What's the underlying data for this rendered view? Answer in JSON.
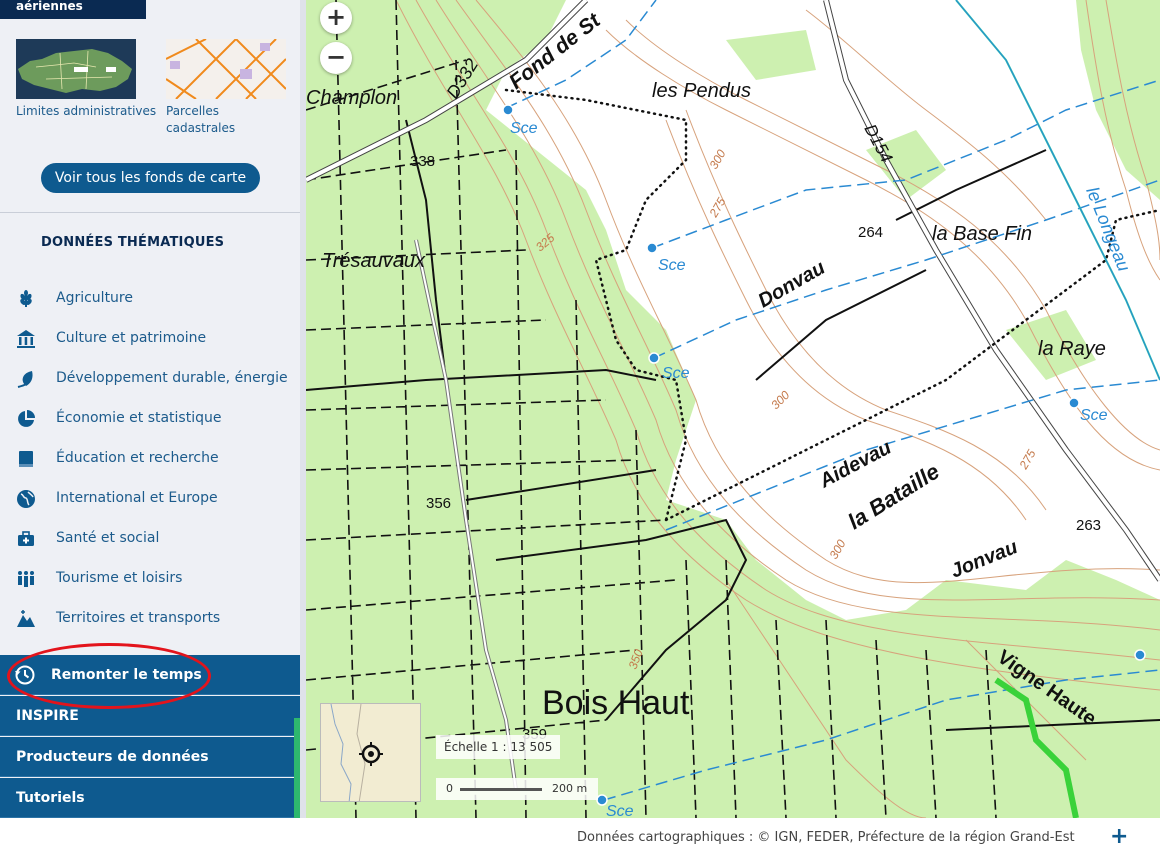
{
  "sidebar": {
    "fonds_title": "aériennes",
    "thumbnails": [
      {
        "label": "Limites administratives"
      },
      {
        "label": "Parcelles cadastrales"
      }
    ],
    "all_backgrounds_button": "Voir tous les fonds de carte",
    "thematic_title": "DONNÉES THÉMATIQUES",
    "thematic_items": [
      {
        "label": "Agriculture",
        "icon": "wheat-icon"
      },
      {
        "label": "Culture et patrimoine",
        "icon": "museum-icon"
      },
      {
        "label": "Développement durable, énergie",
        "icon": "leaf-icon"
      },
      {
        "label": "Économie et statistique",
        "icon": "pie-chart-icon"
      },
      {
        "label": "Éducation et recherche",
        "icon": "book-icon"
      },
      {
        "label": "International et Europe",
        "icon": "globe-icon"
      },
      {
        "label": "Santé et social",
        "icon": "medical-kit-icon"
      },
      {
        "label": "Tourisme et loisirs",
        "icon": "people-icon"
      },
      {
        "label": "Territoires et transports",
        "icon": "terrain-icon"
      }
    ],
    "nav": {
      "history": "Remonter le temps",
      "inspire": "INSPIRE",
      "producers": "Producteurs de données",
      "tutorials": "Tutoriels"
    },
    "accent_color": "#0e5a8f",
    "highlight_color": "#e3141c"
  },
  "map": {
    "zoom_in": "+",
    "zoom_out": "−",
    "scale_label": "Échelle 1 :",
    "scale_value": "13 505",
    "scalebar_start": "0",
    "scalebar_end": "200 m",
    "labels": {
      "champlon": "Champlon",
      "d332": "D332",
      "fond_de_st": "Fond de St",
      "les_pendus": "les Pendus",
      "d154": "D154",
      "tresauvaux": "Trésauvaux",
      "donvau": "Donvau",
      "base_fin": "la Base Fin",
      "longeau": "le Longeau",
      "la_raye": "la Raye",
      "aidevau": "Aidevau",
      "bataille": "la Bataille",
      "jonvau": "Jonvau",
      "bois_haut": "Bois Haut",
      "vigne_haute": "Vigne Haute",
      "sce": "Sce",
      "alt_338": "338",
      "alt_264": "264",
      "alt_356": "356",
      "alt_263": "263",
      "alt_359": "359",
      "c275": "275",
      "c300": "300",
      "c325": "325",
      "c350": "350"
    }
  },
  "footer": {
    "attribution": "Données cartographiques : © IGN, FEDER, Préfecture de la région Grand-Est",
    "expand": "+"
  }
}
